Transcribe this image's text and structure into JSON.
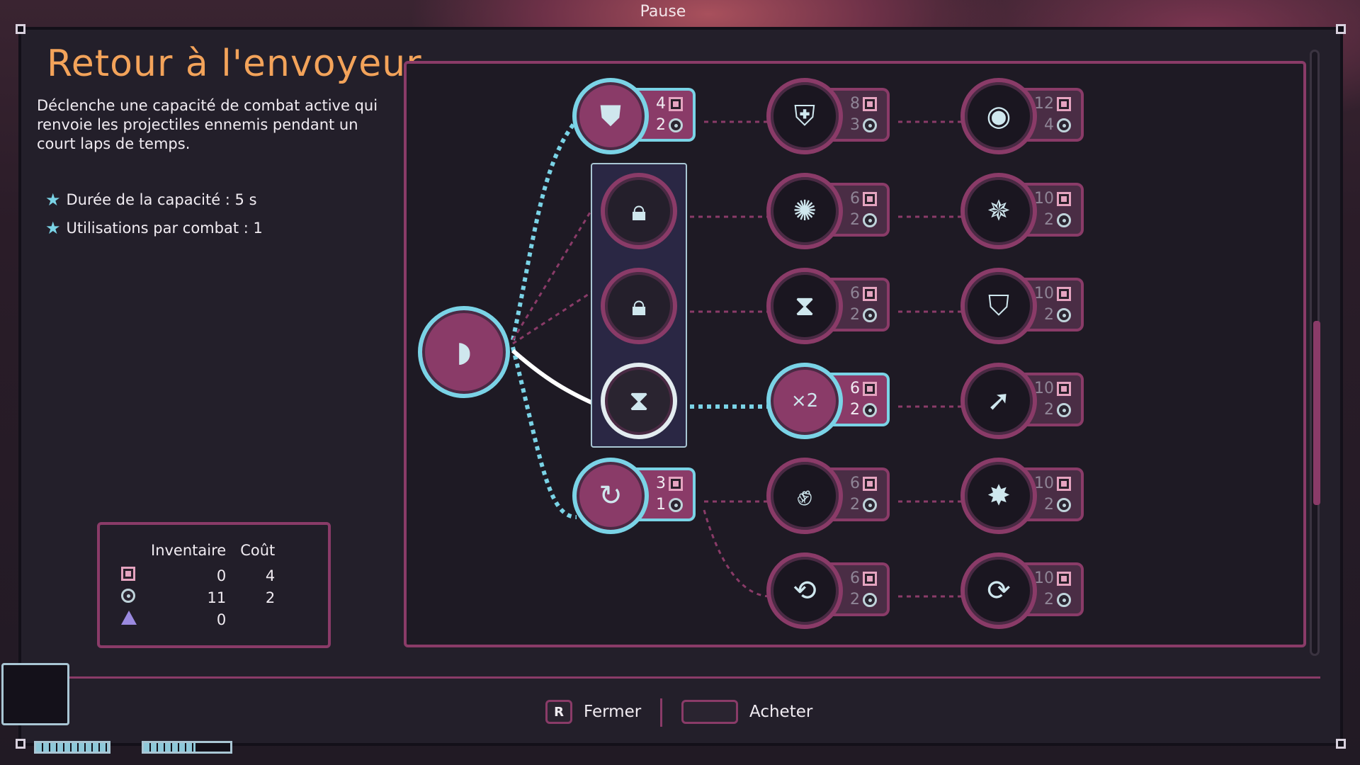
{
  "header": {
    "title": "Pause"
  },
  "skill": {
    "title": "Retour à l'envoyeur",
    "description": "Déclenche une capacité de combat active qui renvoie les projectiles ennemis pendant un court laps de temps.",
    "stats": [
      "Durée de la capacité : 5 s",
      "Utilisations par combat : 1"
    ]
  },
  "currency": {
    "headers": {
      "inventory": "Inventaire",
      "cost": "Coût"
    },
    "rows": [
      {
        "icon": "square-chip-icon",
        "inventory": "0",
        "cost": "4"
      },
      {
        "icon": "gear-coin-icon",
        "inventory": "11",
        "cost": "2"
      },
      {
        "icon": "triangle-shard-icon",
        "inventory": "0",
        "cost": ""
      }
    ]
  },
  "tree": {
    "nodes": [
      {
        "id": "shield-start",
        "icon": "shield-icon",
        "chip": "4",
        "gear": "2",
        "state": "active"
      },
      {
        "id": "shield-2",
        "icon": "shield-badge-icon",
        "chip": "8",
        "gear": "3",
        "state": "dim"
      },
      {
        "id": "shield-3",
        "icon": "shield-orb-icon",
        "chip": "12",
        "gear": "4",
        "state": "dim"
      },
      {
        "id": "lock-1",
        "icon": "lock-icon",
        "state": "locked"
      },
      {
        "id": "storm-1",
        "icon": "storm-icon",
        "chip": "6",
        "gear": "2",
        "state": "dim"
      },
      {
        "id": "storm-2",
        "icon": "figure-storm-icon",
        "chip": "10",
        "gear": "2",
        "state": "dim"
      },
      {
        "id": "lock-2",
        "icon": "lock-icon",
        "state": "locked"
      },
      {
        "id": "time-up",
        "icon": "hourglass-up-icon",
        "chip": "6",
        "gear": "2",
        "state": "dim"
      },
      {
        "id": "halo",
        "icon": "halo-shield-icon",
        "chip": "10",
        "gear": "2",
        "state": "dim"
      },
      {
        "id": "selected",
        "icon": "hourglass-dome-icon",
        "state": "owned"
      },
      {
        "id": "double",
        "icon": "x2-icon",
        "chip": "6",
        "gear": "2",
        "state": "active"
      },
      {
        "id": "slash",
        "icon": "blade-icon",
        "chip": "10",
        "gear": "2",
        "state": "dim"
      },
      {
        "id": "cycle",
        "icon": "cycle-shield-icon",
        "chip": "3",
        "gear": "1",
        "state": "active"
      },
      {
        "id": "fist",
        "icon": "fist-icon",
        "chip": "6",
        "gear": "2",
        "state": "dim"
      },
      {
        "id": "fist-burst",
        "icon": "fist-burst-icon",
        "chip": "10",
        "gear": "2",
        "state": "dim"
      },
      {
        "id": "orb-cycle",
        "icon": "orb-cycle-icon",
        "chip": "6",
        "gear": "2",
        "state": "dim"
      },
      {
        "id": "orb-cycle-2",
        "icon": "orb-cycle-plus-icon",
        "chip": "10",
        "gear": "2",
        "state": "dim"
      }
    ]
  },
  "footer": {
    "close_key": "R",
    "close_label": "Fermer",
    "buy_label": "Acheter"
  },
  "colors": {
    "accent": "#8a3b68",
    "highlight": "#7ad3e6",
    "title": "#f3a35a"
  }
}
